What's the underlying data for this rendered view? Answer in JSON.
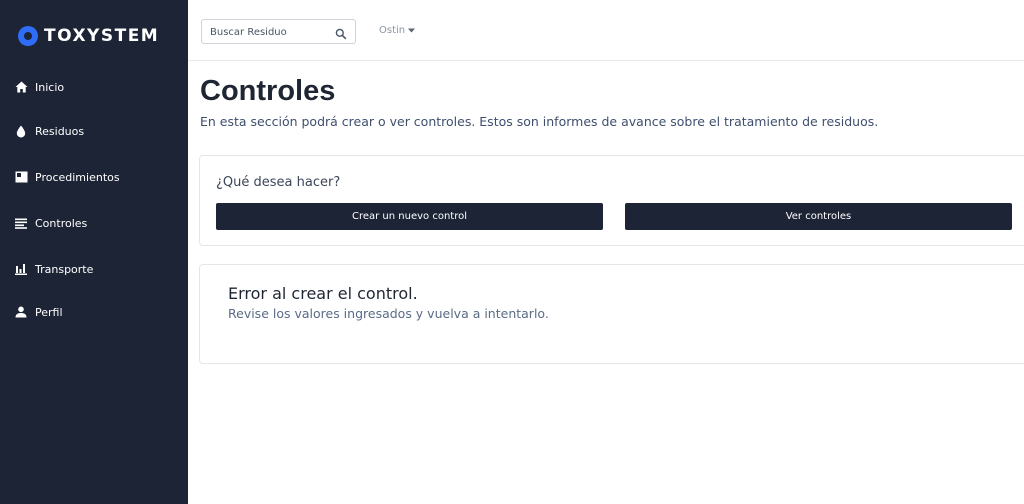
{
  "brand": {
    "name": "TOXYSTEM",
    "accent": "#2f6df6",
    "sidebar_bg": "#1c2436"
  },
  "sidebar": {
    "items": [
      {
        "label": "Inicio",
        "icon": "home-icon"
      },
      {
        "label": "Residuos",
        "icon": "drop-icon"
      },
      {
        "label": "Procedimientos",
        "icon": "panel-icon"
      },
      {
        "label": "Controles",
        "icon": "list-icon"
      },
      {
        "label": "Transporte",
        "icon": "bar-chart-icon"
      },
      {
        "label": "Perfil",
        "icon": "user-icon"
      }
    ]
  },
  "topbar": {
    "search": {
      "placeholder": "Buscar Residuo",
      "icon": "search-icon"
    },
    "user": {
      "name": "Ostin",
      "icon": "caret-down-icon"
    }
  },
  "main": {
    "title": "Controles",
    "description": "En esta sección podrá crear o ver controles. Estos son informes de avance sobre el tratamiento de residuos.",
    "actions_card": {
      "question": "¿Qué desea hacer?",
      "create_button": "Crear un nuevo control",
      "view_button": "Ver controles"
    },
    "error_card": {
      "title": "Error al crear el control.",
      "message": "Revise los valores ingresados y vuelva a intentarlo."
    }
  }
}
